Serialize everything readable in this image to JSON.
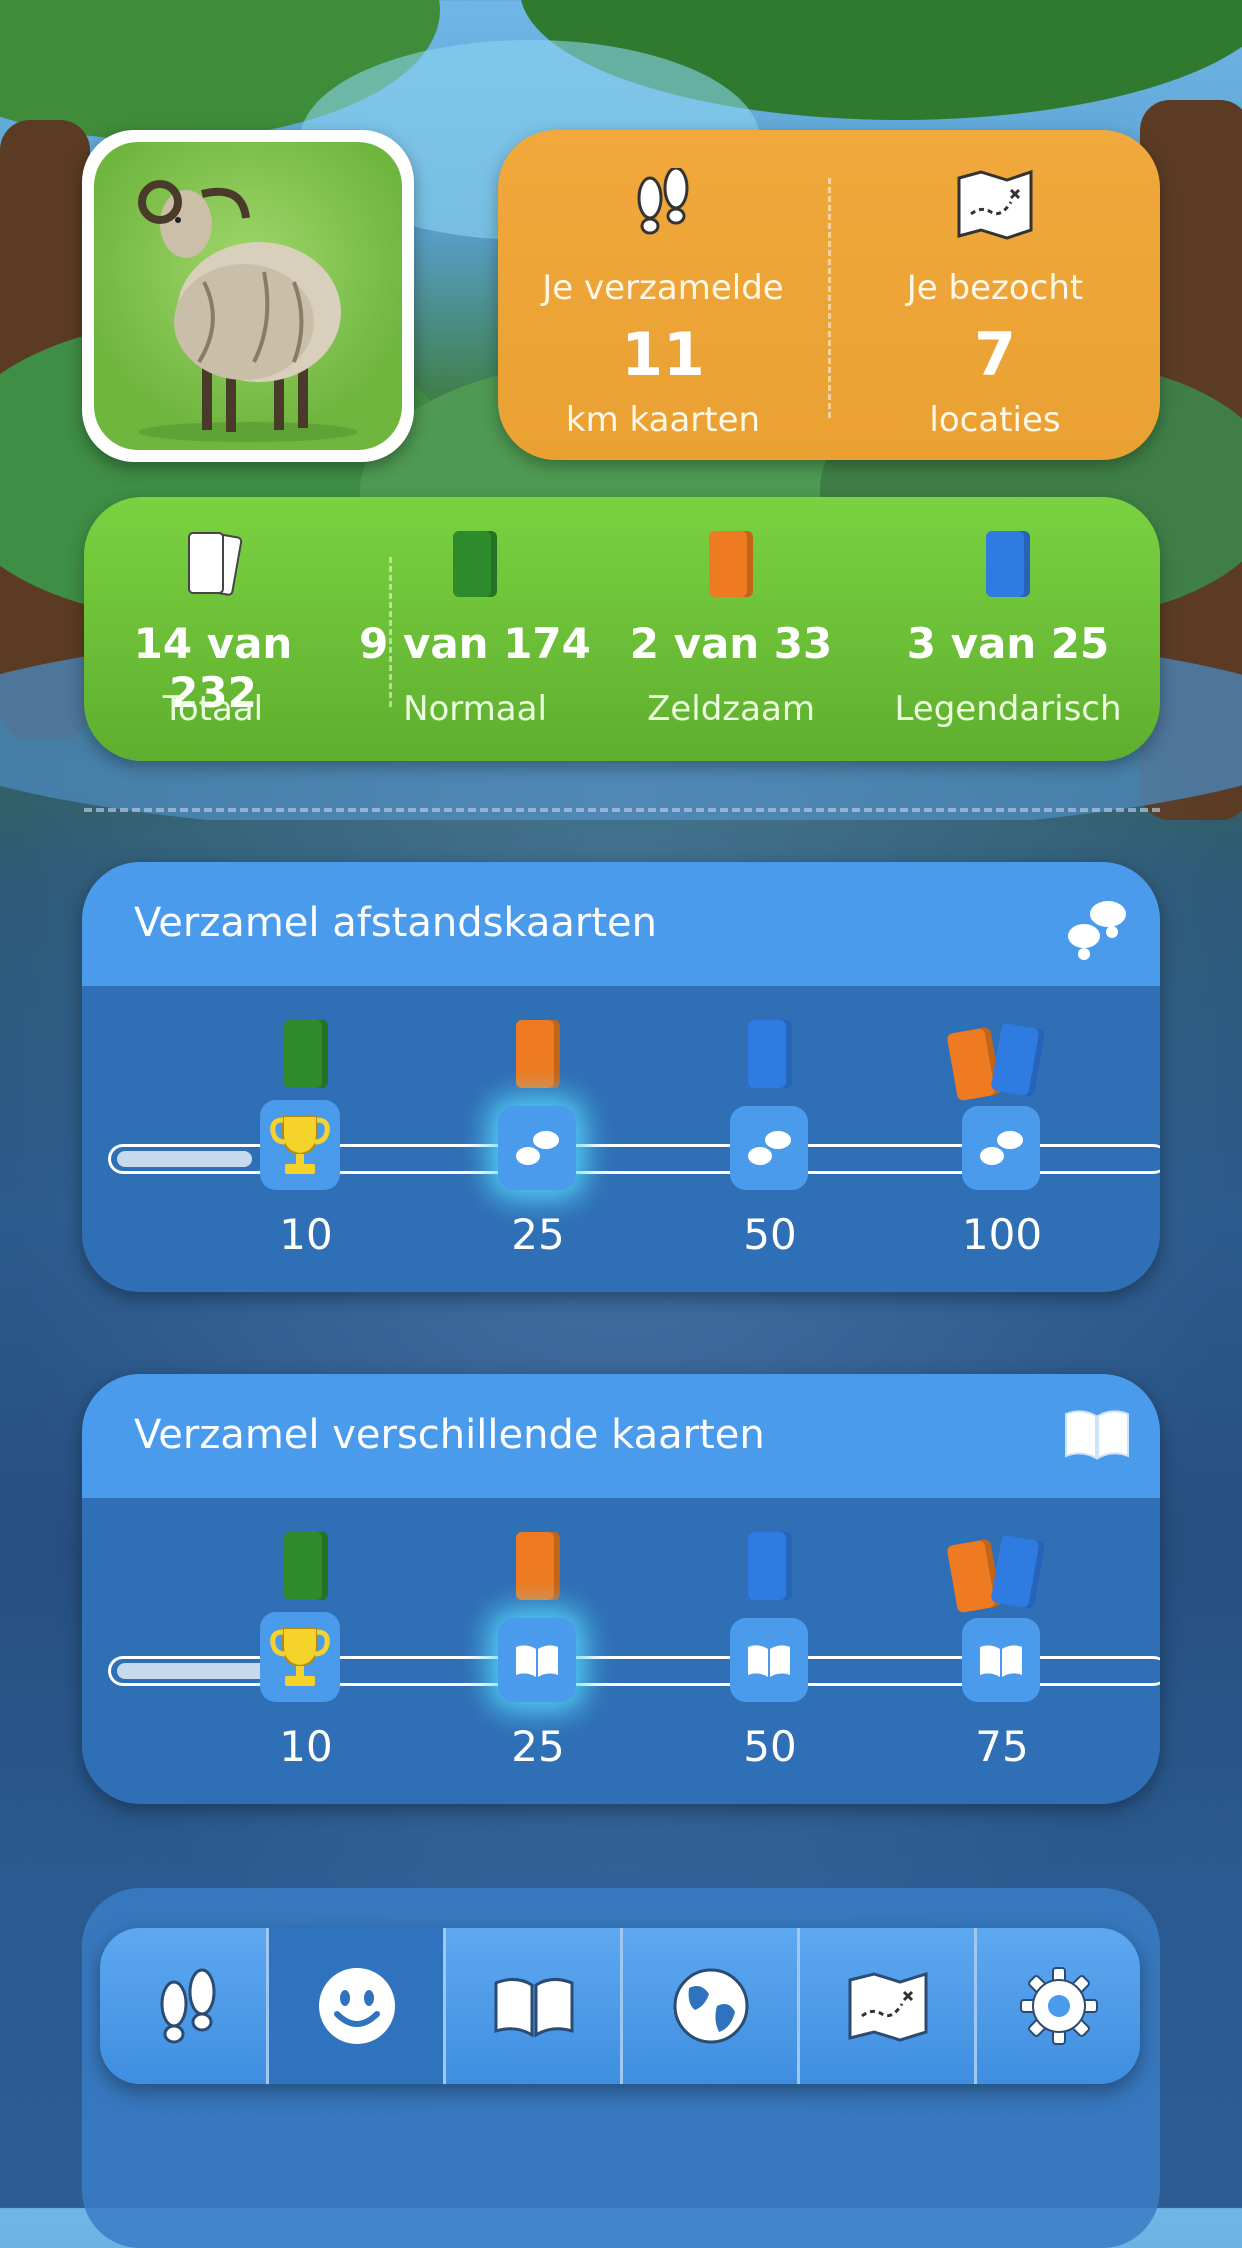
{
  "avatar": {
    "name": "sheep-avatar"
  },
  "stats": {
    "collected": {
      "label_top": "Je verzamelde",
      "value": "11",
      "label_bottom": "km kaarten",
      "icon": "footsteps-icon"
    },
    "visited": {
      "label_top": "Je bezocht",
      "value": "7",
      "label_bottom": "locaties",
      "icon": "treasure-map-icon"
    }
  },
  "collection": [
    {
      "value": "14 van 232",
      "caption": "Totaal",
      "color": "#ffffff"
    },
    {
      "value": "9 van 174",
      "caption": "Normaal",
      "color": "#2e8b2c"
    },
    {
      "value": "2 van 33",
      "caption": "Zeldzaam",
      "color": "#ee7a22"
    },
    {
      "value": "3 van 25",
      "caption": "Legendarisch",
      "color": "#2e7be2"
    }
  ],
  "panels": [
    {
      "title": "Verzamel afstandskaarten",
      "icon": "footsteps-icon",
      "progress": 0.13,
      "milestones": [
        {
          "label": "10",
          "reward": "green",
          "state": "trophy"
        },
        {
          "label": "25",
          "reward": "orange",
          "state": "active"
        },
        {
          "label": "50",
          "reward": "blue",
          "state": "locked"
        },
        {
          "label": "100",
          "reward": "orange+blue",
          "state": "locked"
        }
      ]
    },
    {
      "title": "Verzamel verschillende kaarten",
      "icon": "book-icon",
      "progress": 0.2,
      "milestones": [
        {
          "label": "10",
          "reward": "green",
          "state": "trophy"
        },
        {
          "label": "25",
          "reward": "orange",
          "state": "active"
        },
        {
          "label": "50",
          "reward": "blue",
          "state": "locked"
        },
        {
          "label": "75",
          "reward": "orange+blue",
          "state": "locked"
        }
      ]
    }
  ],
  "nav": [
    {
      "name": "walk-tab",
      "icon": "footsteps-icon"
    },
    {
      "name": "profile-tab",
      "icon": "smiley-icon",
      "selected": true
    },
    {
      "name": "collection-tab",
      "icon": "book-icon"
    },
    {
      "name": "world-tab",
      "icon": "globe-icon"
    },
    {
      "name": "map-tab",
      "icon": "treasure-map-icon"
    },
    {
      "name": "settings-tab",
      "icon": "gear-icon"
    }
  ],
  "colors": {
    "orange_card": "#eaa132",
    "green_card": "#6fc03a",
    "panel": "#2f6fb5",
    "panel_header": "#4a9bec"
  }
}
